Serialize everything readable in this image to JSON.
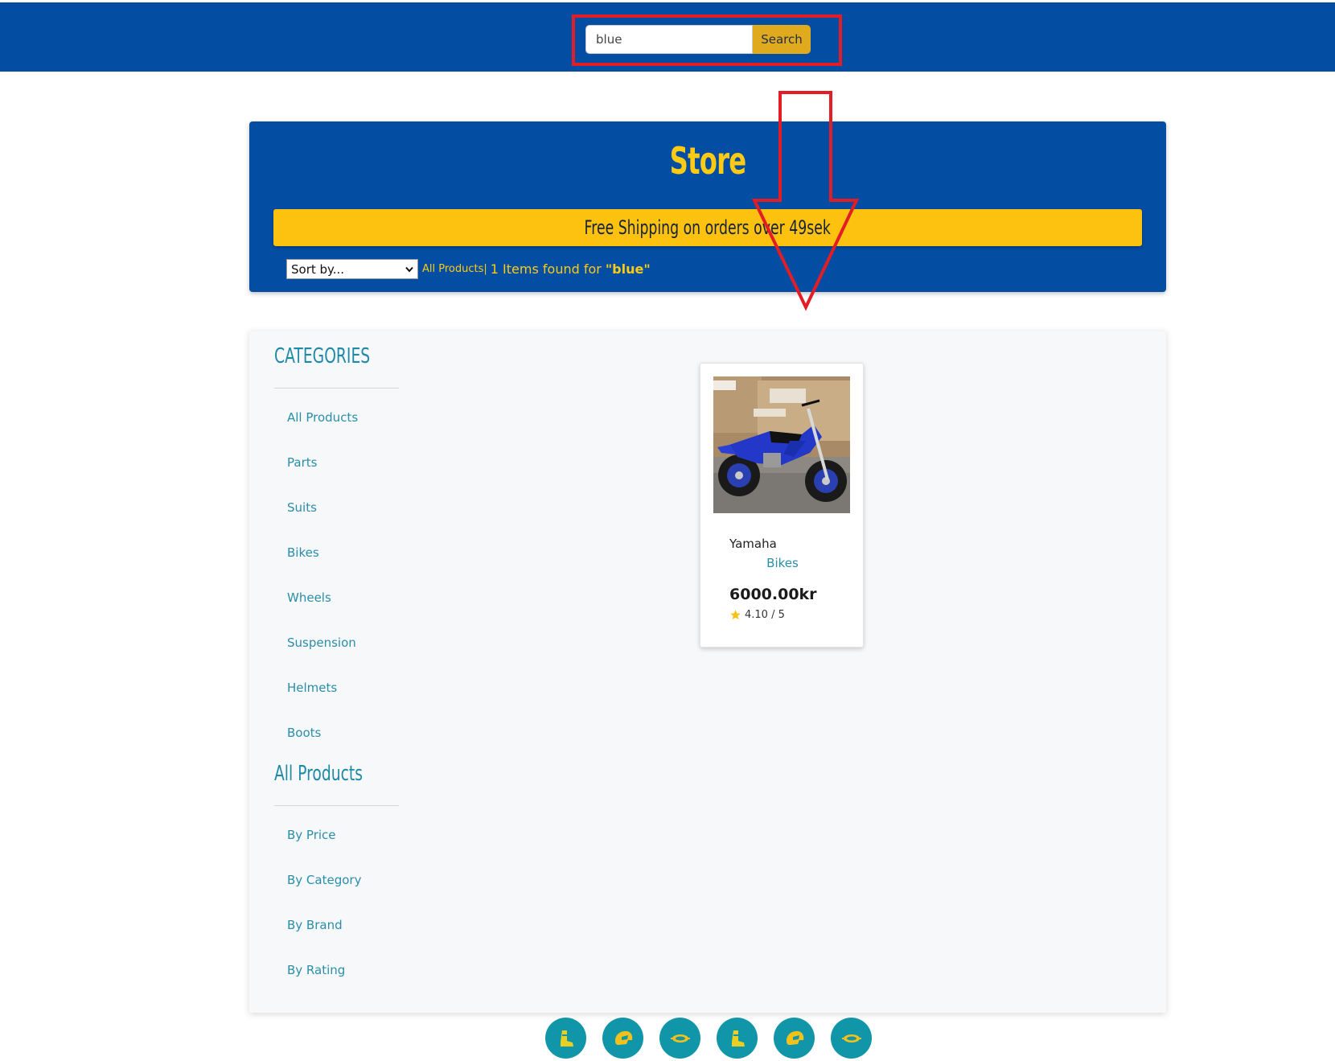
{
  "header": {
    "search_value": "blue",
    "search_button": "Search"
  },
  "store": {
    "title": "Store",
    "banner": "Free Shipping on orders over 49sek",
    "sort_selected": "Sort by...",
    "breadcrumb_link": "All Products",
    "breadcrumb_sep": "|",
    "results_text": "1 Items found for",
    "search_term": "\"blue\""
  },
  "sidebar": {
    "categories_heading": "CATEGORIES",
    "categories": [
      {
        "label": "All Products"
      },
      {
        "label": "Parts"
      },
      {
        "label": "Suits"
      },
      {
        "label": "Bikes"
      },
      {
        "label": "Wheels"
      },
      {
        "label": "Suspension"
      },
      {
        "label": "Helmets"
      },
      {
        "label": "Boots"
      }
    ],
    "sort_heading": "All Products",
    "sort_options": [
      {
        "label": "By Price"
      },
      {
        "label": "By Category"
      },
      {
        "label": "By Brand"
      },
      {
        "label": "By Rating"
      }
    ]
  },
  "product": {
    "name": "Yamaha",
    "category": "Bikes",
    "price": "6000.00kr",
    "rating_text": "4.10 / 5",
    "rating": 4.1,
    "image_label": "blue-yamaha-dirt-bike-photo"
  },
  "footer": {
    "icons": [
      "boot-icon",
      "helmet-icon",
      "goggles-icon",
      "boot-icon",
      "helmet-icon",
      "goggles-icon"
    ]
  },
  "colors": {
    "navy": "#034da2",
    "yellow": "#fdc110",
    "teal": "#1096a8",
    "link": "#2a8ea9",
    "annotation_red": "#e21d26"
  }
}
